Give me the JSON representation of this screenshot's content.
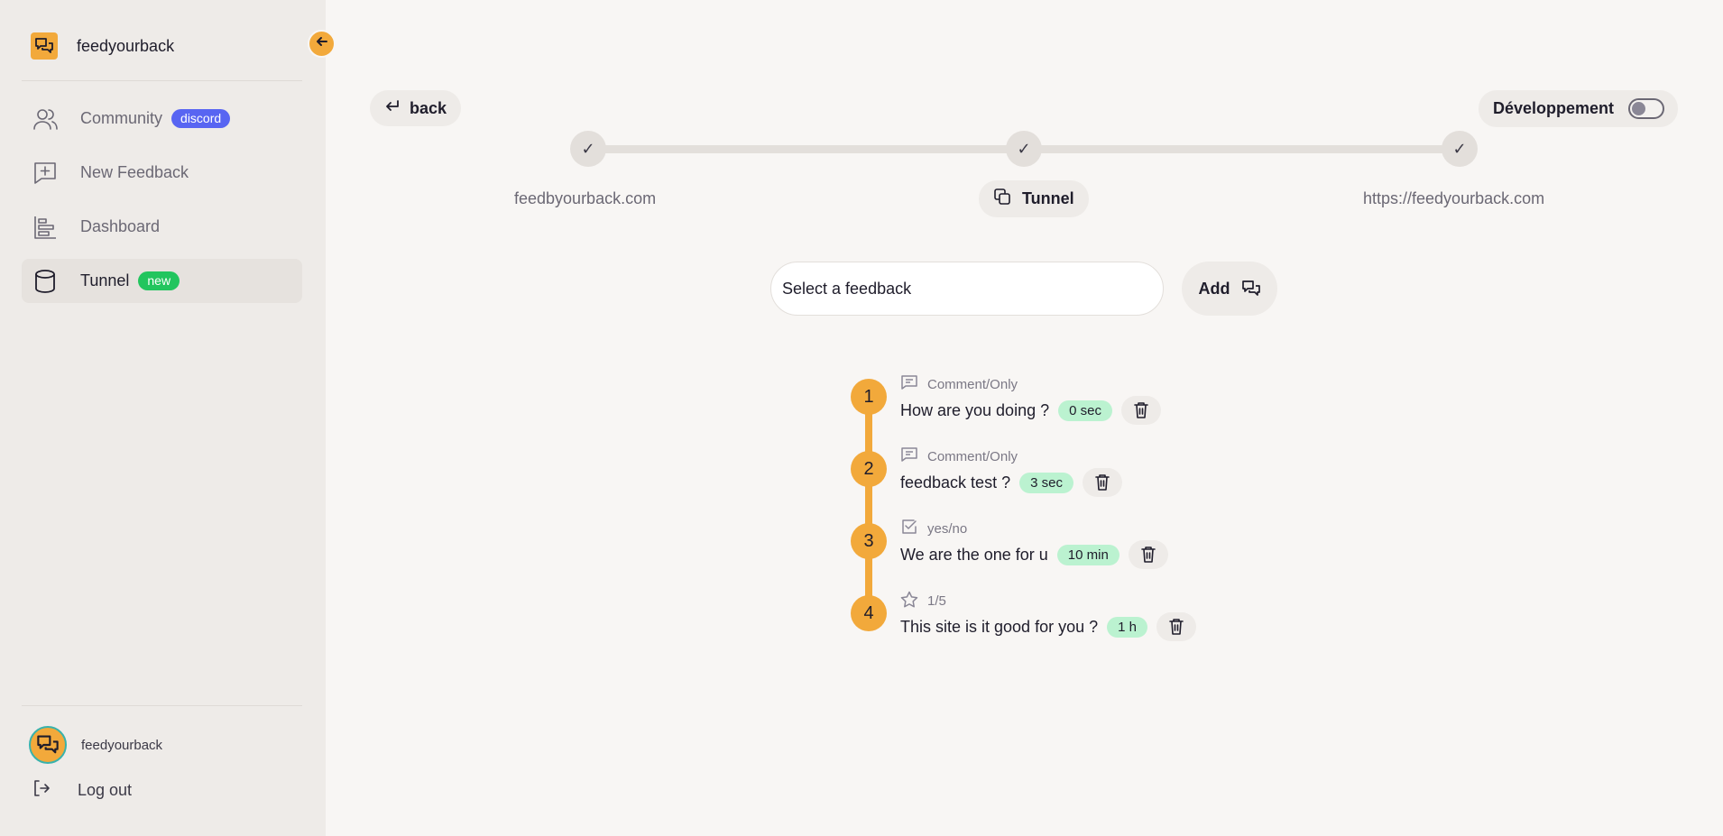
{
  "sidebar": {
    "brand": "feedyourback",
    "items": [
      {
        "label": "Community",
        "badge": "discord"
      },
      {
        "label": "New Feedback"
      },
      {
        "label": "Dashboard"
      },
      {
        "label": "Tunnel",
        "badge": "new"
      }
    ],
    "user": "feedyourback",
    "logout": "Log out"
  },
  "main": {
    "back_label": "back",
    "env_label": "Développement",
    "env_enabled": false,
    "stepper": {
      "check": "✓",
      "left_label": "feedbyourback.com",
      "middle_label": "Tunnel",
      "right_label": "https://feedyourback.com"
    },
    "select_placeholder": "Select a feedback",
    "add_label": "Add"
  },
  "questions": [
    {
      "number": "1",
      "type": "Comment/Only",
      "text": "How are you doing ?",
      "delay": "0 sec"
    },
    {
      "number": "2",
      "type": "Comment/Only",
      "text": "feedback test ?",
      "delay": "3 sec"
    },
    {
      "number": "3",
      "type": "yes/no",
      "text": "We are the one for u",
      "delay": "10 min"
    },
    {
      "number": "4",
      "type": "1/5",
      "text": "This site is it good for you ?",
      "delay": "1 h"
    }
  ],
  "colors": {
    "accent": "#f2a93b",
    "discord": "#5865f2",
    "new_badge": "#22c55e",
    "time_badge": "#bbf2d0",
    "background": "#f8f6f4",
    "sidebar": "#eeebe8"
  },
  "icons": {
    "brand": "chat-bubbles-icon",
    "collapse": "arrow-left-icon",
    "community": "users-icon",
    "new_feedback": "message-plus-icon",
    "dashboard": "bar-chart-icon",
    "tunnel": "database-icon",
    "logout": "logout-icon",
    "back": "return-arrow-icon",
    "tunnel_chip": "copy-icon",
    "add": "chat-bubbles-icon",
    "comment": "message-icon",
    "yes_no": "checkbox-icon",
    "rating": "star-icon",
    "delete": "trash-icon"
  }
}
